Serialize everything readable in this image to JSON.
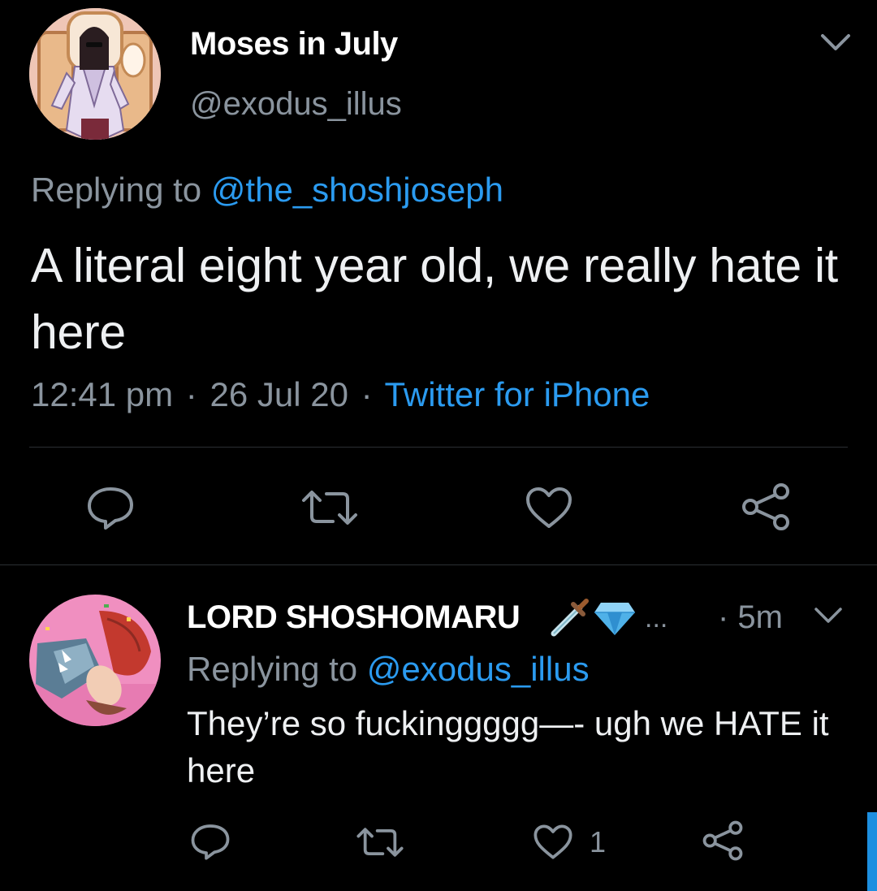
{
  "main_tweet": {
    "display_name": "Moses in July",
    "handle": "@exodus_illus",
    "replying_prefix": "Replying to",
    "replying_to": "@the_shoshjoseph",
    "text": "A literal eight year old, we really hate it here",
    "time": "12:41 pm",
    "separator": "·",
    "date": "26 Jul 20",
    "source": "Twitter for iPhone",
    "icons": [
      "chevron-down-icon",
      "reply-icon",
      "retweet-icon",
      "like-icon",
      "share-icon"
    ]
  },
  "reply_tweet": {
    "display_name": "LORD SHOSHOMARU",
    "name_emojis": [
      "dagger-emoji",
      "gem-emoji"
    ],
    "truncation": "...",
    "time": "· 5m",
    "replying_prefix": "Replying to",
    "replying_to": "@exodus_illus",
    "text": "They’re so fuckinggggg—- ugh we HATE it here",
    "like_count": "1",
    "icons": [
      "chevron-down-icon",
      "reply-icon",
      "retweet-icon",
      "like-icon",
      "share-icon"
    ]
  },
  "colors": {
    "background": "#000000",
    "text_primary": "#eef0f2",
    "text_secondary": "#8a949e",
    "link": "#2b9bf0",
    "divider": "#2b2f33"
  }
}
